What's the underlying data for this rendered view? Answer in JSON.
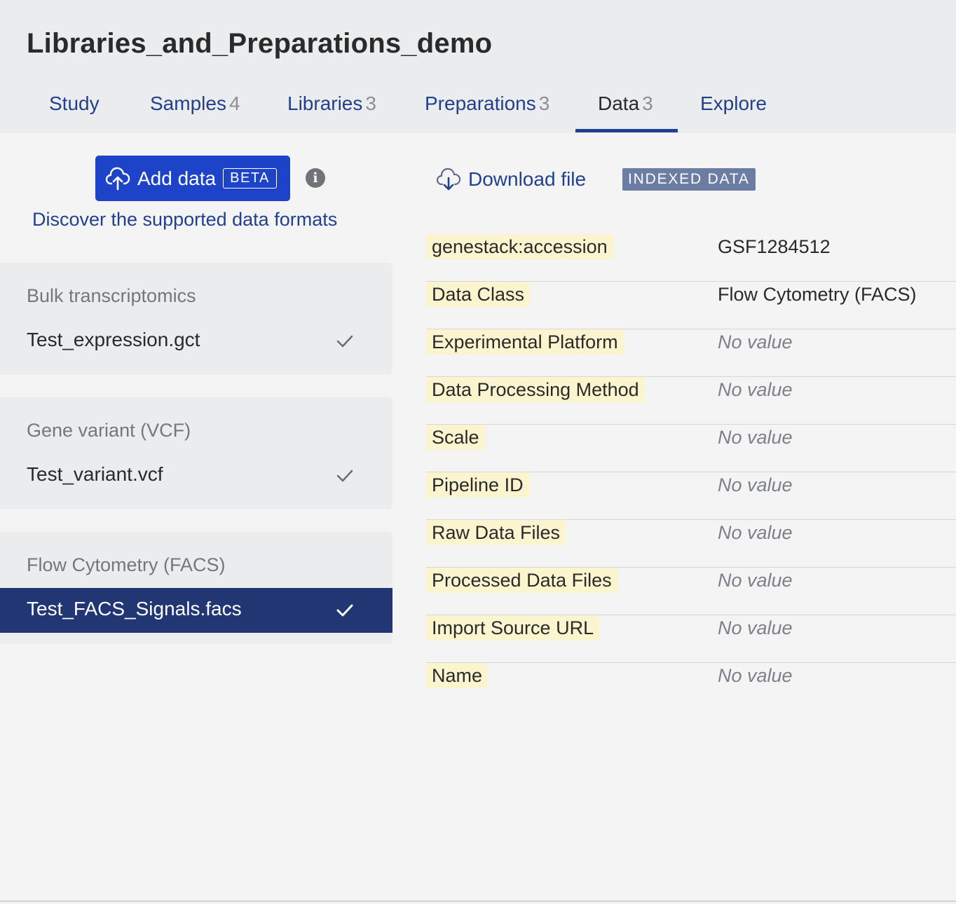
{
  "study": {
    "title": "Libraries_and_Preparations_demo"
  },
  "tabs": [
    {
      "label": "Study",
      "count": ""
    },
    {
      "label": "Samples",
      "count": "4"
    },
    {
      "label": "Libraries",
      "count": "3"
    },
    {
      "label": "Preparations",
      "count": "3"
    },
    {
      "label": "Data",
      "count": "3",
      "active": true
    },
    {
      "label": "Explore",
      "count": ""
    }
  ],
  "left_panel": {
    "add_button_label": "Add data",
    "beta_badge": "BETA",
    "info_icon": "i",
    "discover_link": "Discover the supported data formats",
    "groups": [
      {
        "title": "Bulk transcriptomics",
        "files": [
          {
            "name": "Test_expression.gct",
            "selected": false
          }
        ]
      },
      {
        "title": "Gene variant (VCF)",
        "files": [
          {
            "name": "Test_variant.vcf",
            "selected": false
          }
        ]
      },
      {
        "title": "Flow Cytometry (FACS)",
        "files": [
          {
            "name": "Test_FACS_Signals.facs",
            "selected": true
          }
        ]
      }
    ]
  },
  "right_panel": {
    "download_label": "Download file",
    "indexed_badge": "INDEXED DATA",
    "metadata": [
      {
        "key": "genestack:accession",
        "value": "GSF1284512",
        "empty": false
      },
      {
        "key": "Data Class",
        "value": "Flow Cytometry (FACS)",
        "empty": false
      },
      {
        "key": "Experimental Platform",
        "value": "No value",
        "empty": true
      },
      {
        "key": "Data Processing Method",
        "value": "No value",
        "empty": true
      },
      {
        "key": "Scale",
        "value": "No value",
        "empty": true
      },
      {
        "key": "Pipeline ID",
        "value": "No value",
        "empty": true
      },
      {
        "key": "Raw Data Files",
        "value": "No value",
        "empty": true
      },
      {
        "key": "Processed Data Files",
        "value": "No value",
        "empty": true
      },
      {
        "key": "Import Source URL",
        "value": "No value",
        "empty": true
      },
      {
        "key": "Name",
        "value": "No value",
        "empty": true
      }
    ]
  },
  "colors": {
    "primary": "#1d43c9",
    "link": "#22408e",
    "selected_row": "#213672",
    "key_highlight": "#fbf5cf",
    "badge": "#6c7da3"
  },
  "icons": {
    "add": "cloud-upload-icon",
    "info": "info-icon",
    "download": "cloud-download-icon",
    "check": "check-icon"
  }
}
